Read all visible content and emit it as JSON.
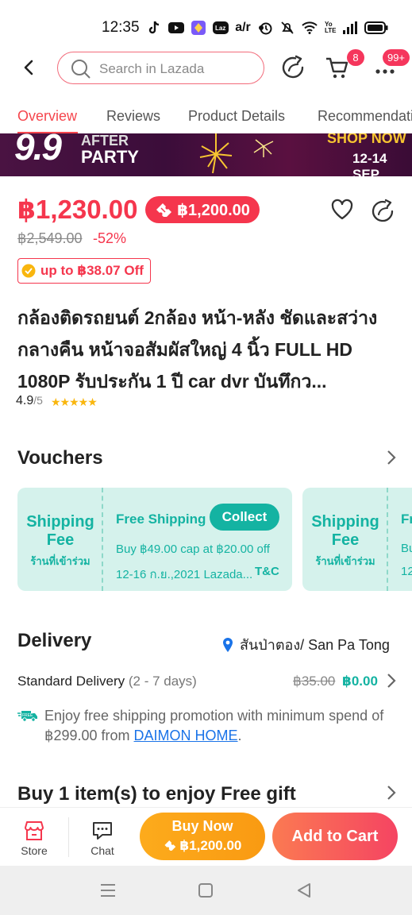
{
  "status_bar": {
    "time": "12:35",
    "icons_left": [
      "tiktok-icon",
      "youtube-icon",
      "app-icon",
      "lazada-icon",
      "air-icon",
      "dot-icon"
    ],
    "icons_right": [
      "alarm-icon",
      "mute-icon",
      "wifi-icon",
      "volte-icon",
      "signal-icon",
      "battery-icon"
    ],
    "lte_label": "Yo LTE"
  },
  "top_bar": {
    "search_placeholder": "Search in Lazada",
    "cart_badge": "8",
    "more_badge": "99+"
  },
  "tabs": [
    {
      "label": "Overview",
      "active": true
    },
    {
      "label": "Reviews"
    },
    {
      "label": "Product Details"
    },
    {
      "label": "Recommendations"
    }
  ],
  "banner": {
    "big": "9.9",
    "after_line1": "AFTER",
    "after_line2": "PARTY",
    "shop_now": "SHOP NOW",
    "dates": "12-14 SEP"
  },
  "product": {
    "price": "฿1,230.00",
    "voucher_price": "฿1,200.00",
    "original_price": "฿2,549.00",
    "discount": "-52%",
    "coupon": "up to ฿38.07 Off",
    "title": "กล้องติดรถยนต์ 2กล้อง หน้า-หลัง ชัดและสว่างกลางคืน หน้าจอสัมผัสใหญ่ 4 นิ้ว FULL HD 1080P รับประกัน 1 ปี car dvr บันทึกว...",
    "rating": "4.9",
    "rating_of": "/5",
    "stars": 5
  },
  "vouchers": {
    "heading": "Vouchers",
    "cards": [
      {
        "left_line1": "Shipping",
        "left_line2": "Fee",
        "left_shop": "ร้านที่เข้าร่วม",
        "title": "Free Shipping",
        "button": "Collect",
        "line1": "Buy ฿49.00 cap at ฿20.00 off",
        "line2": "12-16 ก.ย.,2021 Lazada...",
        "tc": "T&C"
      },
      {
        "left_line1": "Shipping",
        "left_line2": "Fee",
        "left_shop": "ร้านที่เข้าร่วม",
        "title": "Fr",
        "line1": "Bu",
        "line2": "12"
      }
    ]
  },
  "delivery": {
    "heading": "Delivery",
    "location": "สันป่าตอง/ San Pa Tong",
    "standard_label": "Standard Delivery",
    "standard_days": "(2 - 7 days)",
    "old_fee": "฿35.00",
    "new_fee": "฿0.00",
    "free_text_before": "Enjoy free shipping promotion with minimum spend of ฿299.00 from ",
    "free_link": "DAIMON HOME",
    "free_text_after": ".",
    "free_icon_label": "FREE"
  },
  "gift": {
    "heading": "Buy 1 item(s) to enjoy Free gift"
  },
  "bottom_bar": {
    "store": "Store",
    "chat": "Chat",
    "buy_now": "Buy Now",
    "buy_now_price": "฿1,200.00",
    "add_to_cart": "Add to Cart"
  },
  "colors": {
    "accent": "#f5364d",
    "teal": "#14b3a2",
    "buy_now": "#fdab1c",
    "add_to_cart": "#f54462"
  }
}
